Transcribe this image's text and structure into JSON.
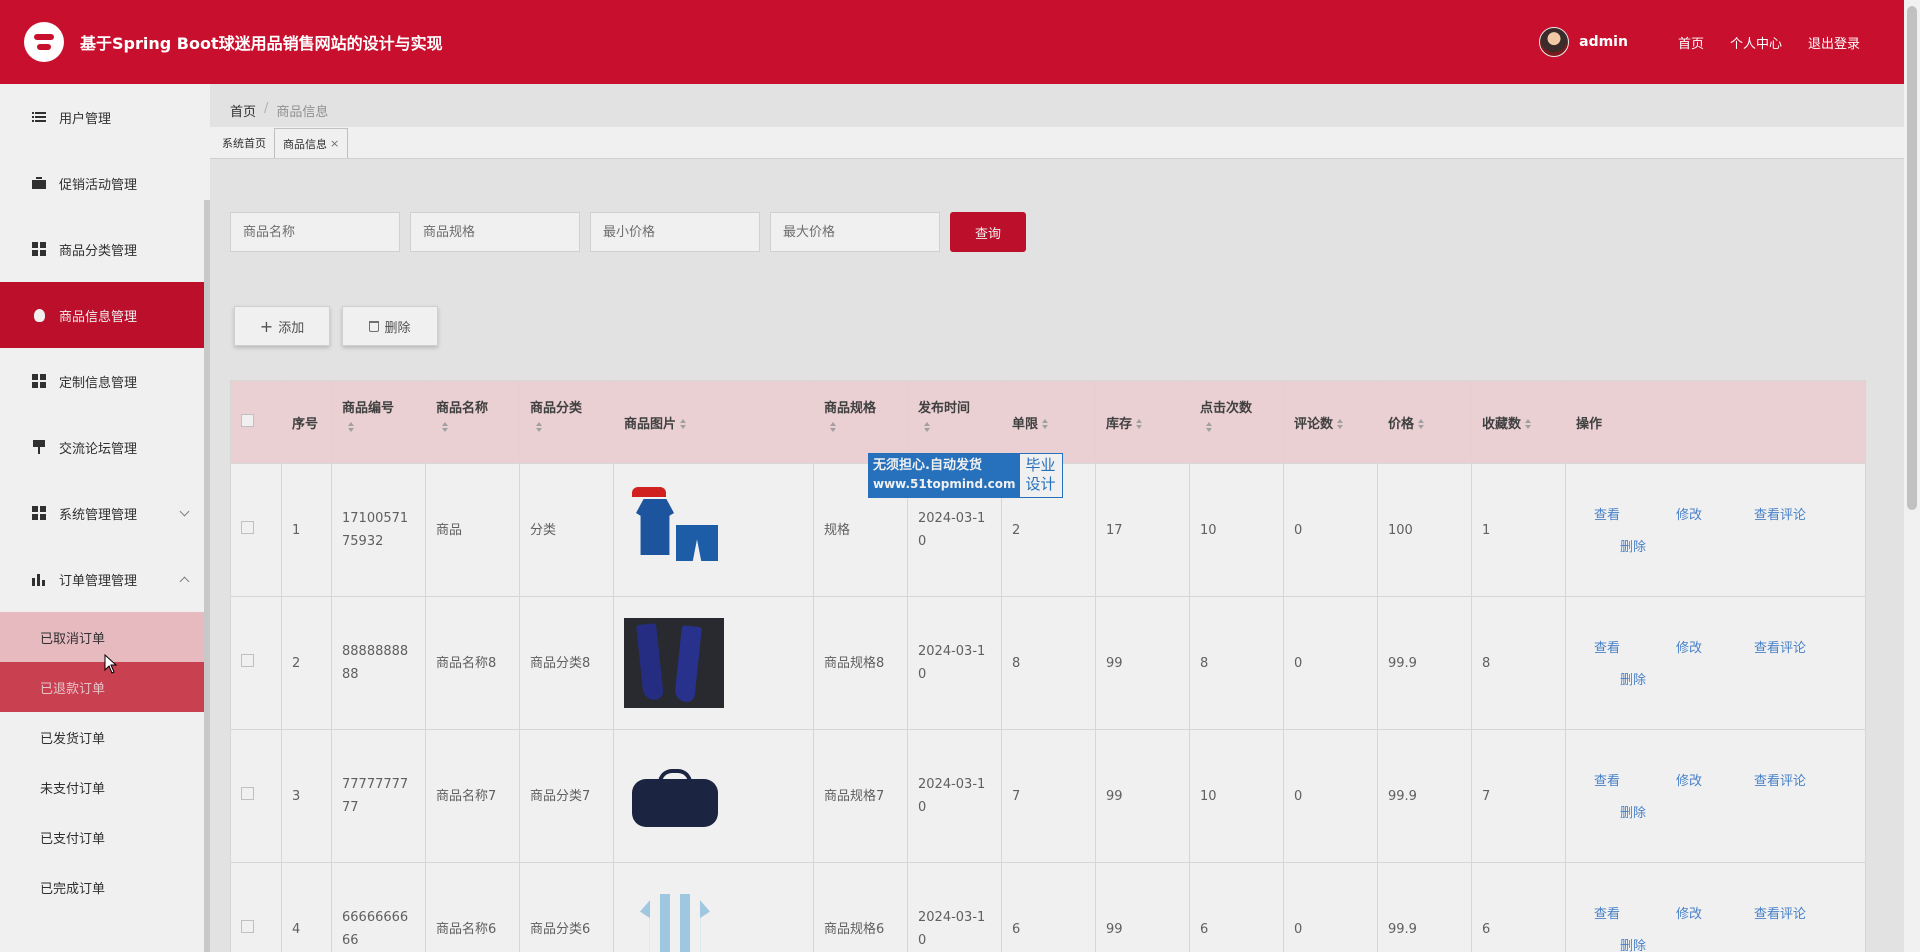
{
  "header": {
    "title": "基于Spring Boot球迷用品销售网站的设计与实现",
    "username": "admin",
    "links": [
      "首页",
      "个人中心",
      "退出登录"
    ]
  },
  "sidebar": {
    "items": [
      {
        "label": "用户管理",
        "icon": "list-icon"
      },
      {
        "label": "促销活动管理",
        "icon": "briefcase-icon"
      },
      {
        "label": "商品分类管理",
        "icon": "grid-icon"
      },
      {
        "label": "商品信息管理",
        "icon": "bulb-icon"
      },
      {
        "label": "定制信息管理",
        "icon": "grid-icon"
      },
      {
        "label": "交流论坛管理",
        "icon": "pin-icon"
      },
      {
        "label": "系统管理管理",
        "icon": "grid-icon"
      },
      {
        "label": "订单管理管理",
        "icon": "bar-chart-icon"
      }
    ],
    "order_submenu": [
      "已取消订单",
      "已退款订单",
      "已发货订单",
      "未支付订单",
      "已支付订单",
      "已完成订单"
    ]
  },
  "breadcrumb": {
    "home": "首页",
    "current": "商品信息"
  },
  "tabs": [
    "系统首页",
    "商品信息"
  ],
  "search": {
    "placeholders": [
      "商品名称",
      "商品规格",
      "最小价格",
      "最大价格"
    ],
    "button": "查询"
  },
  "actions": {
    "add": "添加",
    "delete": "删除"
  },
  "table": {
    "headers": [
      "序号",
      "商品编号",
      "商品名称",
      "商品分类",
      "商品图片",
      "商品规格",
      "发布时间",
      "单限",
      "库存",
      "点击次数",
      "评论数",
      "价格",
      "收藏数",
      "操作"
    ],
    "rows": [
      {
        "no": "1",
        "code": "1710057175932",
        "name": "商品",
        "category": "分类",
        "image": "blue-football-kit",
        "spec": "规格",
        "date": "2024-03-10",
        "limit": "2",
        "stock": "17",
        "clicks": "10",
        "comments": "0",
        "price": "100",
        "favorites": "1"
      },
      {
        "no": "2",
        "code": "8888888888",
        "name": "商品名称8",
        "category": "商品分类8",
        "image": "blue-football-socks",
        "spec": "商品规格8",
        "date": "2024-03-10",
        "limit": "8",
        "stock": "99",
        "clicks": "8",
        "comments": "0",
        "price": "99.9",
        "favorites": "8"
      },
      {
        "no": "3",
        "code": "7777777777",
        "name": "商品名称7",
        "category": "商品分类7",
        "image": "navy-sports-bag",
        "spec": "商品规格7",
        "date": "2024-03-10",
        "limit": "7",
        "stock": "99",
        "clicks": "10",
        "comments": "0",
        "price": "99.9",
        "favorites": "7"
      },
      {
        "no": "4",
        "code": "6666666666",
        "name": "商品名称6",
        "category": "商品分类6",
        "image": "striped-jersey",
        "spec": "商品规格6",
        "date": "2024-03-10",
        "limit": "6",
        "stock": "99",
        "clicks": "6",
        "comments": "0",
        "price": "99.9",
        "favorites": "6"
      }
    ],
    "row_ops": [
      "查看",
      "修改",
      "查看评论",
      "删除"
    ]
  },
  "watermark": {
    "line1": "无须担心.自动发货",
    "line2": "www.51topmind.com",
    "right1": "毕业",
    "right2": "设计"
  },
  "colors": {
    "primary": "#c8102e",
    "link": "#4d8ad6",
    "header_row": "#f9dde1"
  }
}
